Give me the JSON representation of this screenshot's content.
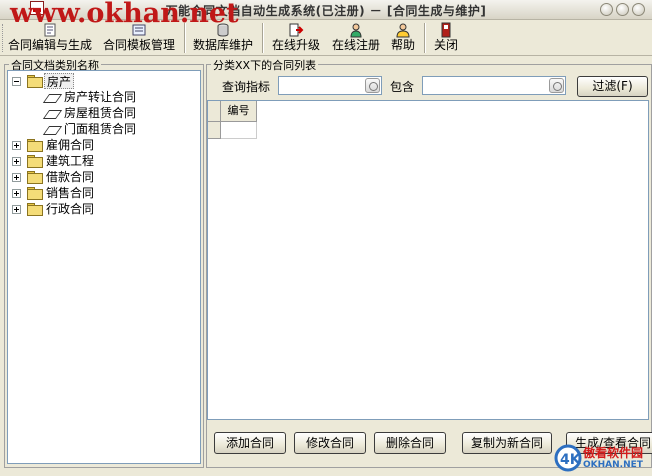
{
  "window": {
    "title": "万能合同文档自动生成系统(已注册) － [合同生成与维护]",
    "watermark": "www.okhan.net"
  },
  "toolbar": {
    "items": [
      {
        "label": "合同编辑与生成",
        "icon": "edit-icon"
      },
      {
        "label": "合同模板管理",
        "icon": "template-icon"
      },
      {
        "label": "数据库维护",
        "icon": "database-icon"
      },
      {
        "label": "在线升级",
        "icon": "upgrade-icon"
      },
      {
        "label": "在线注册",
        "icon": "register-icon"
      },
      {
        "label": "帮助",
        "icon": "help-icon"
      },
      {
        "label": "关闭",
        "icon": "close-icon"
      }
    ]
  },
  "tree_panel": {
    "title": "合同文档类别名称",
    "nodes": [
      {
        "label": "房产",
        "expanded": true,
        "children": [
          "房产转让合同",
          "房屋租赁合同",
          "门面租赁合同"
        ]
      },
      {
        "label": "雇佣合同",
        "expanded": false
      },
      {
        "label": "建筑工程",
        "expanded": false
      },
      {
        "label": "借款合同",
        "expanded": false
      },
      {
        "label": "销售合同",
        "expanded": false
      },
      {
        "label": "行政合同",
        "expanded": false
      }
    ]
  },
  "list_panel": {
    "title": "分类XX下的合同列表",
    "query_label": "查询指标",
    "query_value": "",
    "contains_label": "包含",
    "contains_value": "",
    "filter_button": "过滤(F)",
    "columns": [
      "编号"
    ],
    "buttons": [
      "添加合同",
      "修改合同",
      "删除合同",
      "复制为新合同",
      "生成/查看合同"
    ]
  },
  "logo": {
    "brand": "傲看软件园",
    "url_text": "OKHAN.NET"
  },
  "colors": {
    "watermark": "#c01818",
    "window_bg": "#ece9d8",
    "tree_border": "#7f9db9"
  }
}
